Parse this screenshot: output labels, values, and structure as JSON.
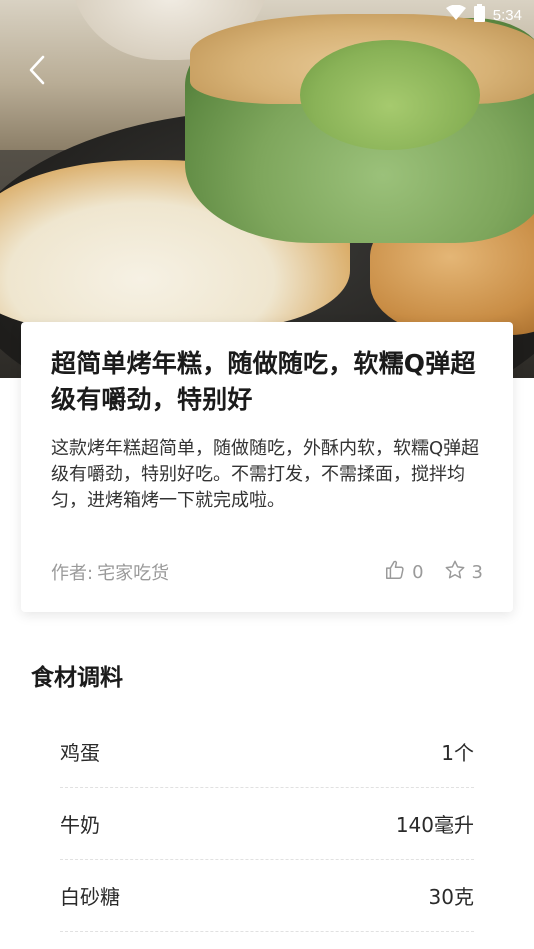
{
  "status_bar": {
    "time": "5:34"
  },
  "recipe": {
    "title": "超简单烤年糕，随做随吃，软糯Q弹超级有嚼劲，特别好",
    "description": "这款烤年糕超简单，随做随吃，外酥内软，软糯Q弹超级有嚼劲，特别好吃。不需打发，不需揉面，搅拌均匀，进烤箱烤一下就完成啦。",
    "author_label": "作者:",
    "author_name": "宅家吃货",
    "likes": "0",
    "favorites": "3"
  },
  "ingredients": {
    "section_title": "食材调料",
    "items": [
      {
        "name": "鸡蛋",
        "amount": "1个"
      },
      {
        "name": "牛奶",
        "amount": "140毫升"
      },
      {
        "name": "白砂糖",
        "amount": "30克"
      }
    ]
  },
  "icons": {
    "back": "chevron-left-icon",
    "like": "thumbs-up-icon",
    "favorite": "star-icon",
    "wifi": "wifi-icon",
    "battery": "battery-icon"
  },
  "colors": {
    "meta_text": "#9a9a9a",
    "title_text": "#1b1b1b"
  }
}
